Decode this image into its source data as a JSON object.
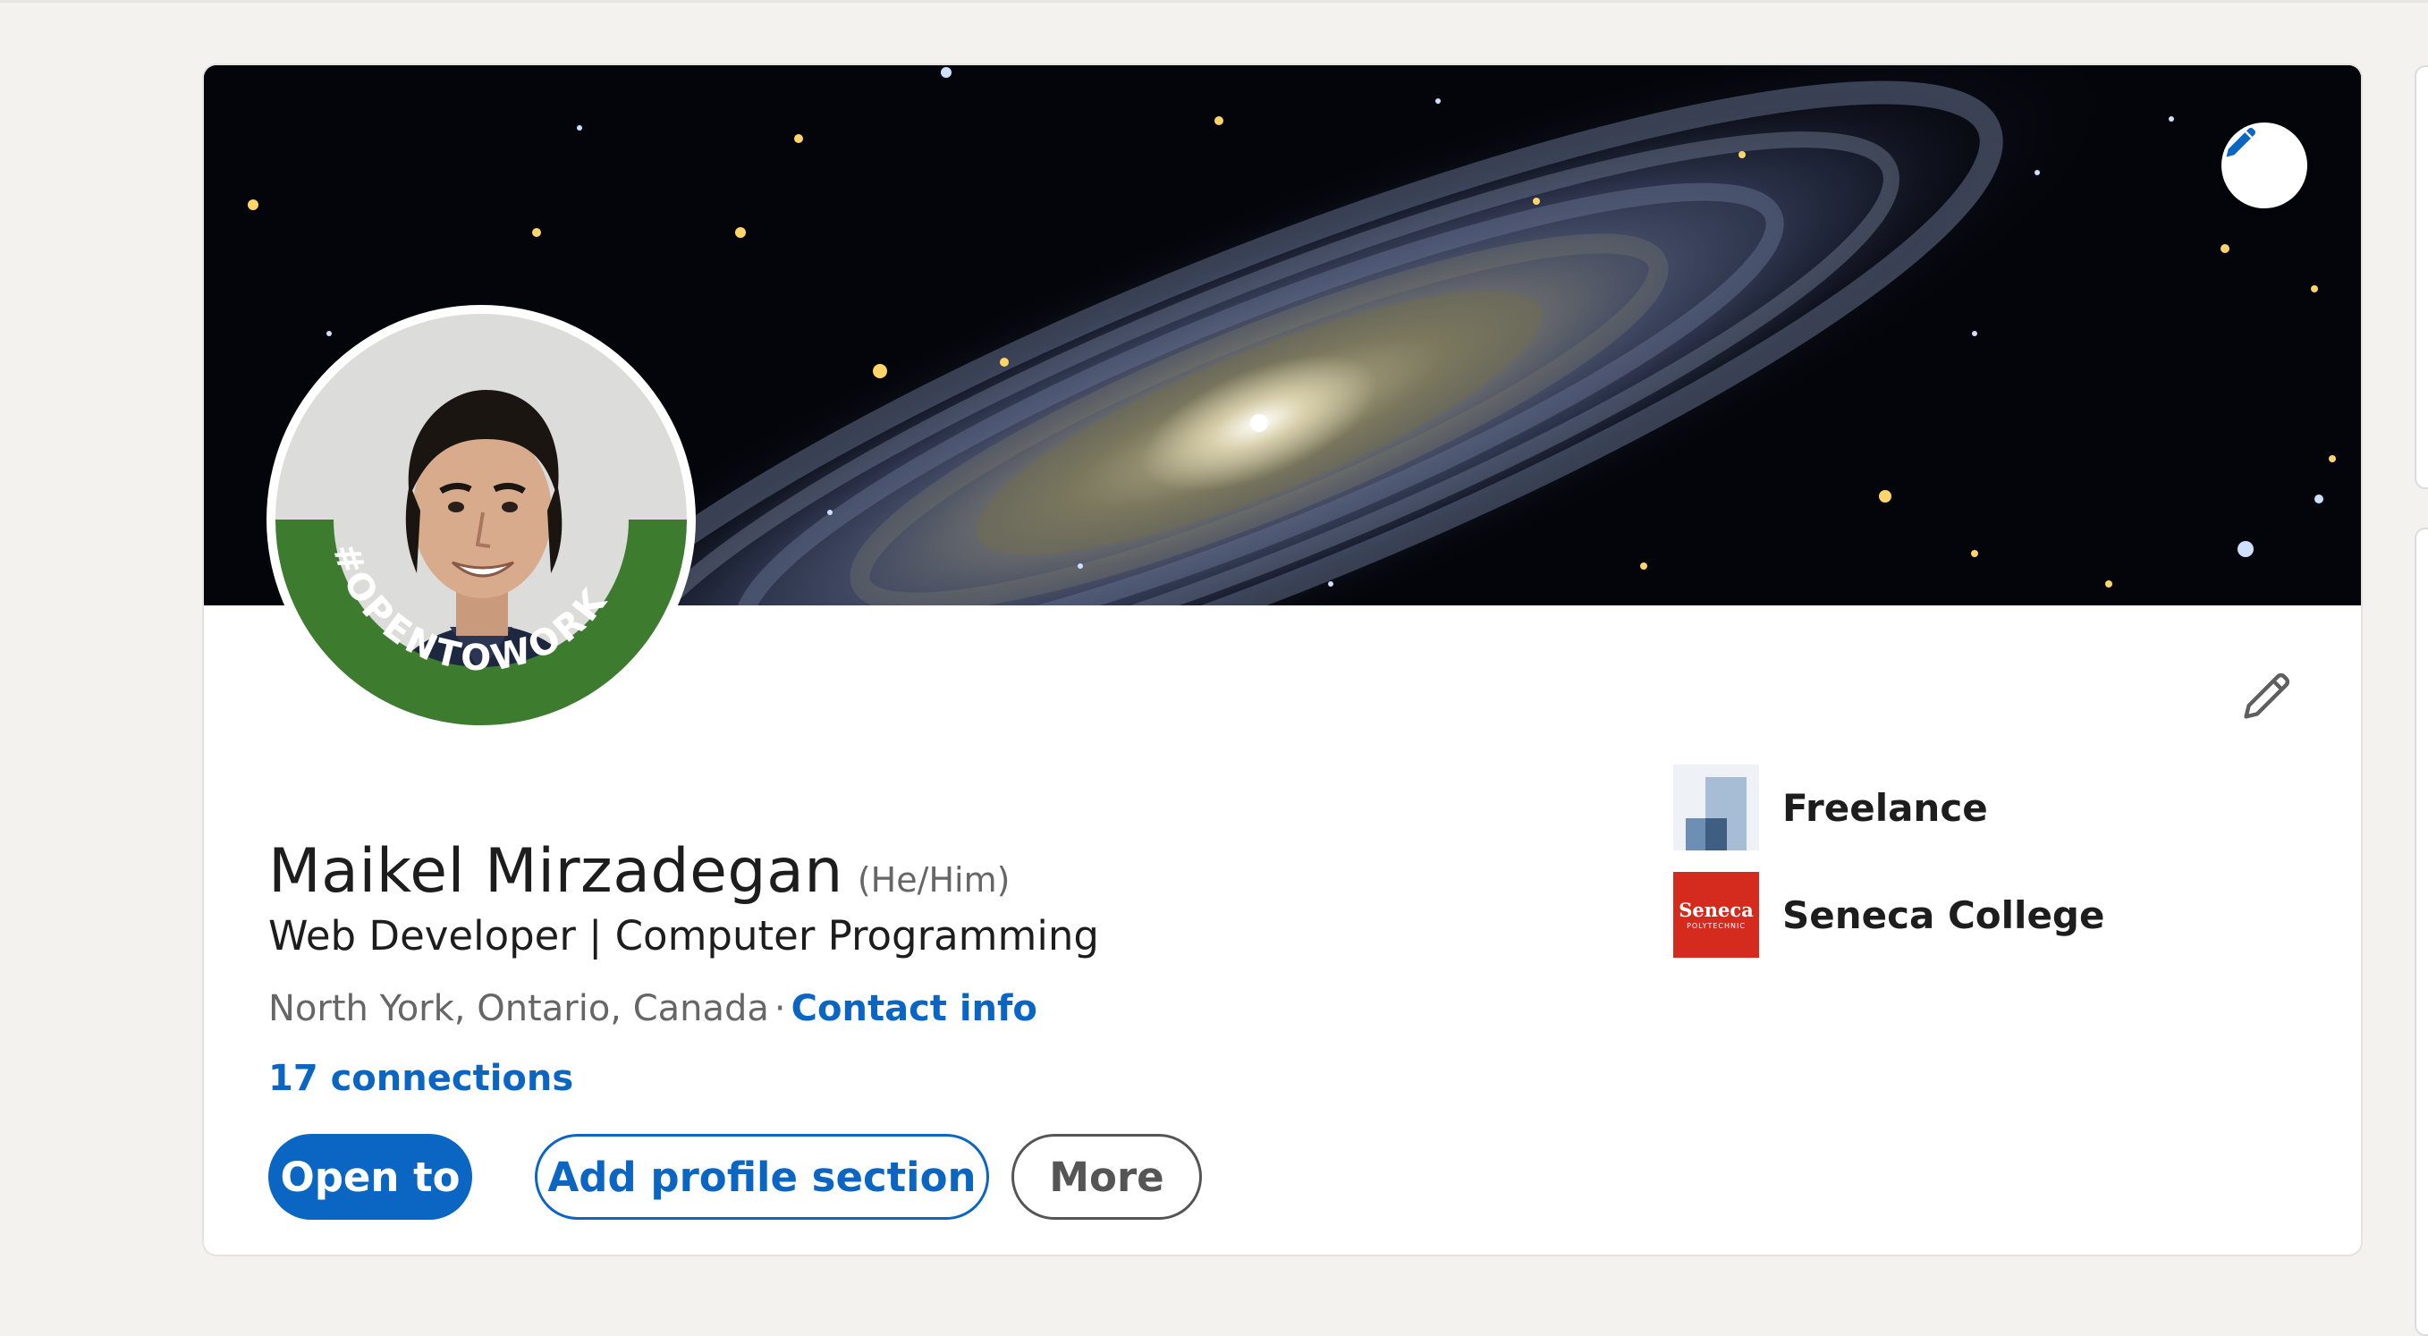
{
  "profile": {
    "name": "Maikel Mirzadegan",
    "pronouns": "(He/Him)",
    "headline": "Web Developer | Computer Programming",
    "location": "North York, Ontario, Canada",
    "separator": "·",
    "contact_link": "Contact info",
    "connections": "17 connections",
    "open_to_work_frame": "#OPENTOWORK"
  },
  "actions": {
    "open_to": "Open to",
    "add_section": "Add profile section",
    "more": "More"
  },
  "experience": [
    {
      "name": "Freelance",
      "logo": "freelance-logo"
    },
    {
      "name": "Seneca College",
      "logo": "seneca-logo",
      "logo_text": "Seneca",
      "logo_subtext": "POLYTECHNIC"
    }
  ],
  "icons": {
    "banner_edit": "pencil-icon",
    "intro_edit": "pencil-outline-icon"
  },
  "colors": {
    "accent": "#0a66c2",
    "open_to_work_green": "#3d7b2f",
    "seneca_red": "#d52b1e",
    "background": "#f3f2ef"
  }
}
